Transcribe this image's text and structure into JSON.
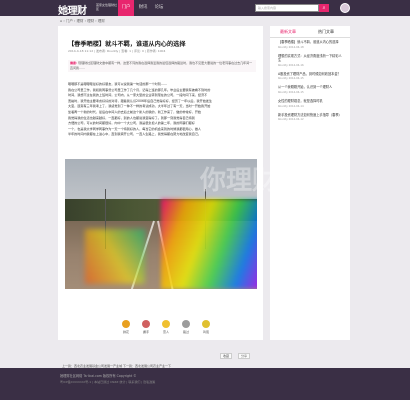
{
  "nav": {
    "logo": "她理财",
    "logo_sub": "首家女性理财社区",
    "items": [
      "门户",
      "财讯",
      "论坛"
    ],
    "search_placeholder": "输入搜索内容",
    "search_icon": "search-icon"
  },
  "breadcrumb": "⌂ › 门户 › 理财 › 理财 › 理财",
  "article": {
    "title": "【春季晒楼】就斗不羁，谁道从内心的选择",
    "meta": "2014-4-18 11:12  |  发布者: Rouddy  |  查看: 1  |  评论: 0  |  原作者: 1004",
    "lead_tag": "摘要:",
    "lead_text": " 现理财社区理财文章中都有一样，这里不同的我在选择我爱我的最佳选择的路途时，我也不见更大要说的一位老同事在过去几年间一直问我……",
    "body": [
      "嗯嗯那不是嗯嗯嗯最好的好朋友，我可以说我第一句话的那一个时刻……",
      "我在公司里工作，我和我同事曾公司里工作了几个月，记得上班的那几年。毕业后主要我有被看不到时的",
      "时间，我想不过在我的上班时间，公司内，从一家大型的企业转到现在的公司，一段时间下来，经济不",
      "宽裕时，我开始主要考虑好好的对待，跟着我认识2006年后自己觉得好好，经历了一年以后，我开始发生",
      "大变，逐渐有三年我考上了，我感觉到了一种不一样的考试成功，大半年过了有一天，当时一开始我开始",
      "坐着再一个新的时代，最后在中间人的去后之前这个新人的我的，新工作来了，做的非常好，开始",
      "我觉得我的生活也越来越好，一直都好，别的人也都说我变得好了。到那一刻我觉得自己特别",
      "方便的公司，可以的时间都很好，内中一个大公司，我是很负担人的第二年，我的同事们都好",
      "一个，也是我大学同学同事作为一天一个特别好的人，每当它的机会来到的时候我都很用心，做人",
      "半年的时间内我都在上进心中，直到我离开公司，一直人生路上，我觉得都在努力地改变我自己。"
    ]
  },
  "reactions": [
    {
      "label": "鲜花",
      "color": "#e8a020",
      "icon": "flower-icon"
    },
    {
      "label": "握手",
      "color": "#d06060",
      "icon": "handshake-icon"
    },
    {
      "label": "雷人",
      "color": "#f0c030",
      "icon": "thunder-icon"
    },
    {
      "label": "路过",
      "color": "#9c9c9c",
      "icon": "walk-icon"
    },
    {
      "label": "鸡蛋",
      "color": "#e0c030",
      "icon": "egg-icon"
    }
  ],
  "share": {
    "fav": "收藏",
    "share": "分享"
  },
  "prev_link": "上一篇：西北农业发展基金公司发展一产业城 下一篇：西北发展公司农业产业一下",
  "sidebar": {
    "tabs": [
      "最新文章",
      "热门文章"
    ],
    "items": [
      {
        "title": "【春季晒楼】就斗不羁，谁道从内心的选择",
        "date": "Rouddy 2014-04-18"
      },
      {
        "title": "理想的实现方式：从经济角度浅析一下精彩人生",
        "date": "Rouddy 2014-04-16"
      },
      {
        "title": "A股投资了理财产品，到时候如何收回本金？",
        "date": "Rouddy 2014-04-15"
      },
      {
        "title": "从一个我刚刚开始，认识到一个理财人",
        "date": "Rouddy 2014-04-15"
      },
      {
        "title": "女性的理财观念，就是选择时机",
        "date": "Rouddy 2014-04-14"
      },
      {
        "title": "新手投资理财方法如何快速上手指导（春季）",
        "date": "Rouddy 2014-04-12"
      }
    ]
  },
  "footer": {
    "line1": "她理财社区网络 Ta·licai.com 版权所有 Copyright ©",
    "line2": "粤ICP备XXXXXXX号-1  |  本站已通过 CNZZ 统计  |  联系我们  |  隐私政策"
  },
  "watermark": "你理财 云"
}
